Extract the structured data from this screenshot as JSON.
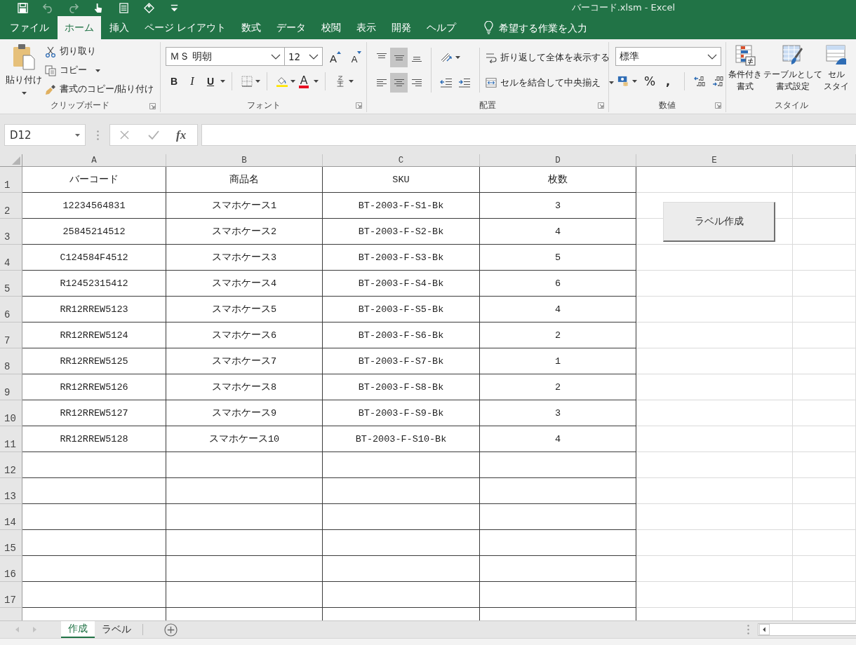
{
  "window": {
    "title": "バーコード.xlsm - Excel"
  },
  "quick_access": [
    {
      "kind": "save",
      "disabled": false
    },
    {
      "kind": "undo",
      "disabled": true
    },
    {
      "kind": "redo",
      "disabled": true
    },
    {
      "kind": "touch",
      "disabled": false
    },
    {
      "kind": "form",
      "disabled": false
    },
    {
      "kind": "tag",
      "disabled": false
    },
    {
      "kind": "customize",
      "disabled": false
    }
  ],
  "ribbon_tabs": [
    {
      "label": "ファイル",
      "selected": false
    },
    {
      "label": "ホーム",
      "selected": true
    },
    {
      "label": "挿入",
      "selected": false
    },
    {
      "label": "ページ レイアウト",
      "selected": false
    },
    {
      "label": "数式",
      "selected": false
    },
    {
      "label": "データ",
      "selected": false
    },
    {
      "label": "校閲",
      "selected": false
    },
    {
      "label": "表示",
      "selected": false
    },
    {
      "label": "開発",
      "selected": false
    },
    {
      "label": "ヘルプ",
      "selected": false
    }
  ],
  "tell_me": {
    "placeholder": "希望する作業を入力"
  },
  "clipboard": {
    "label": "クリップボード",
    "paste": "貼り付け",
    "cut": "切り取り",
    "copy": "コピー",
    "format_painter": "書式のコピー/貼り付け"
  },
  "font": {
    "label": "フォント",
    "font_name": "ＭＳ 明朝",
    "font_size": "12",
    "grow": "A",
    "shrink": "A",
    "bold": "B",
    "italic": "I",
    "underline": "U",
    "font_color": "A"
  },
  "alignment": {
    "label": "配置",
    "vertical": [
      {
        "selected": false
      },
      {
        "selected": true
      },
      {
        "selected": false
      }
    ],
    "horizontal": [
      {
        "selected": false
      },
      {
        "selected": true
      },
      {
        "selected": false
      }
    ],
    "wrap_text": "折り返して全体を表示する",
    "merge_center": "セルを結合して中央揃え"
  },
  "number": {
    "label": "数値",
    "format": "標準",
    "percent": "%",
    "comma": ","
  },
  "styles": {
    "label": "スタイル",
    "buttons": [
      {
        "lines": [
          "条件付き",
          "書式"
        ]
      },
      {
        "lines": [
          "テーブルとして",
          "書式設定"
        ]
      },
      {
        "lines": [
          "セル",
          "スタイ"
        ]
      }
    ]
  },
  "formula_bar": {
    "name_box": "D12",
    "function": "fx"
  },
  "sheet": {
    "columns": [
      "A",
      "B",
      "C",
      "D",
      "E"
    ],
    "row_numbers": [
      "1",
      "2",
      "3",
      "4",
      "5",
      "6",
      "7",
      "8",
      "9",
      "10",
      "11",
      "12",
      "13",
      "14",
      "15",
      "16",
      "17"
    ],
    "rows": [
      [
        "バーコード",
        "商品名",
        "SKU",
        "枚数"
      ],
      [
        "12234564831",
        "スマホケース1",
        "BT-2003-F-S1-Bk",
        "3"
      ],
      [
        "25845214512",
        "スマホケース2",
        "BT-2003-F-S2-Bk",
        "4"
      ],
      [
        "C124584F4512",
        "スマホケース3",
        "BT-2003-F-S3-Bk",
        "5"
      ],
      [
        "R12452315412",
        "スマホケース4",
        "BT-2003-F-S4-Bk",
        "6"
      ],
      [
        "RR12RREW5123",
        "スマホケース5",
        "BT-2003-F-S5-Bk",
        "4"
      ],
      [
        "RR12RREW5124",
        "スマホケース6",
        "BT-2003-F-S6-Bk",
        "2"
      ],
      [
        "RR12RREW5125",
        "スマホケース7",
        "BT-2003-F-S7-Bk",
        "1"
      ],
      [
        "RR12RREW5126",
        "スマホケース8",
        "BT-2003-F-S8-Bk",
        "2"
      ],
      [
        "RR12RREW5127",
        "スマホケース9",
        "BT-2003-F-S9-Bk",
        "3"
      ],
      [
        "RR12RREW5128",
        "スマホケース10",
        "BT-2003-F-S10-Bk",
        "4"
      ]
    ]
  },
  "macro_button": {
    "label": "ラベル作成"
  },
  "sheet_tabs": [
    {
      "label": "作成",
      "selected": true
    },
    {
      "label": "ラベル",
      "selected": false
    }
  ]
}
